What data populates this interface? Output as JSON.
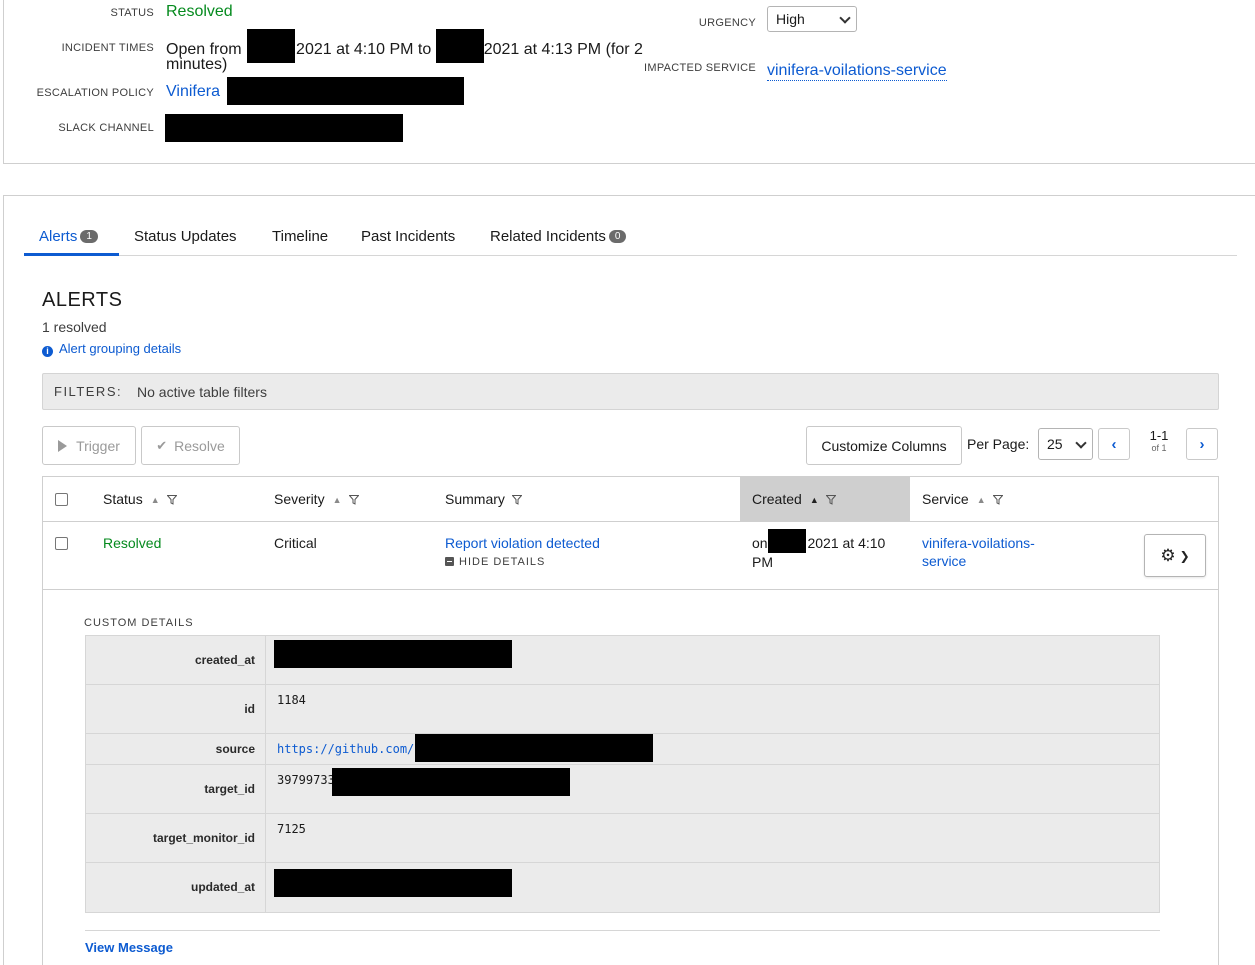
{
  "incident": {
    "status_label": "STATUS",
    "status_value": "Resolved",
    "times_label": "INCIDENT TIMES",
    "times_open_from": "Open from",
    "times_start_rest": "2021 at 4:10 PM to",
    "times_end_rest": "2021 at 4:13 PM (for 2",
    "times_duration_tail": "minutes)",
    "escalation_label": "ESCALATION POLICY",
    "escalation_value": "Vinifera",
    "slack_label": "SLACK CHANNEL",
    "urgency_label": "URGENCY",
    "urgency_value": "High",
    "impacted_label": "IMPACTED SERVICE",
    "impacted_value": "vinifera-voilations-service"
  },
  "tabs": [
    {
      "label": "Alerts",
      "badge": "1"
    },
    {
      "label": "Status Updates"
    },
    {
      "label": "Timeline"
    },
    {
      "label": "Past Incidents"
    },
    {
      "label": "Related Incidents",
      "badge": "0"
    }
  ],
  "alerts": {
    "heading": "ALERTS",
    "resolved_count": "1 resolved",
    "grouping_link": "Alert grouping details",
    "filters_label": "FILTERS:",
    "filters_value": "No active table filters",
    "trigger_label": "Trigger",
    "resolve_label": "Resolve",
    "customize_label": "Customize Columns",
    "per_page_label": "Per Page:",
    "per_page_value": "25",
    "range_main": "1-1",
    "range_sub": "of 1",
    "columns": [
      "Status",
      "Severity",
      "Summary",
      "Created",
      "Service"
    ],
    "rows": [
      {
        "status": "Resolved",
        "severity": "Critical",
        "summary": "Report violation detected",
        "hide_details": "HIDE DETAILS",
        "created_prefix": "on",
        "created_rest": "2021 at 4:10",
        "created_tail": "PM",
        "service_line1": "vinifera-voilations-",
        "service_line2": "service"
      }
    ],
    "custom_details_label": "CUSTOM DETAILS",
    "custom_details": [
      {
        "key": "created_at",
        "value": ""
      },
      {
        "key": "id",
        "value": "1184"
      },
      {
        "key": "source",
        "value": "https://github.com/"
      },
      {
        "key": "target_id",
        "value": "39799733"
      },
      {
        "key": "target_monitor_id",
        "value": "7125"
      },
      {
        "key": "updated_at",
        "value": ""
      }
    ],
    "view_message": "View Message"
  },
  "colors": {
    "link_blue": "#0d5bd1",
    "resolved_green": "#058a1e",
    "filter_bg": "#ebebeb"
  },
  "icons": [
    "info-icon",
    "play-icon",
    "check-icon",
    "sort-icon",
    "filter-icon",
    "chevron-left-icon",
    "chevron-right-icon",
    "gear-icon",
    "chevron-down-icon",
    "minus-square-icon"
  ]
}
